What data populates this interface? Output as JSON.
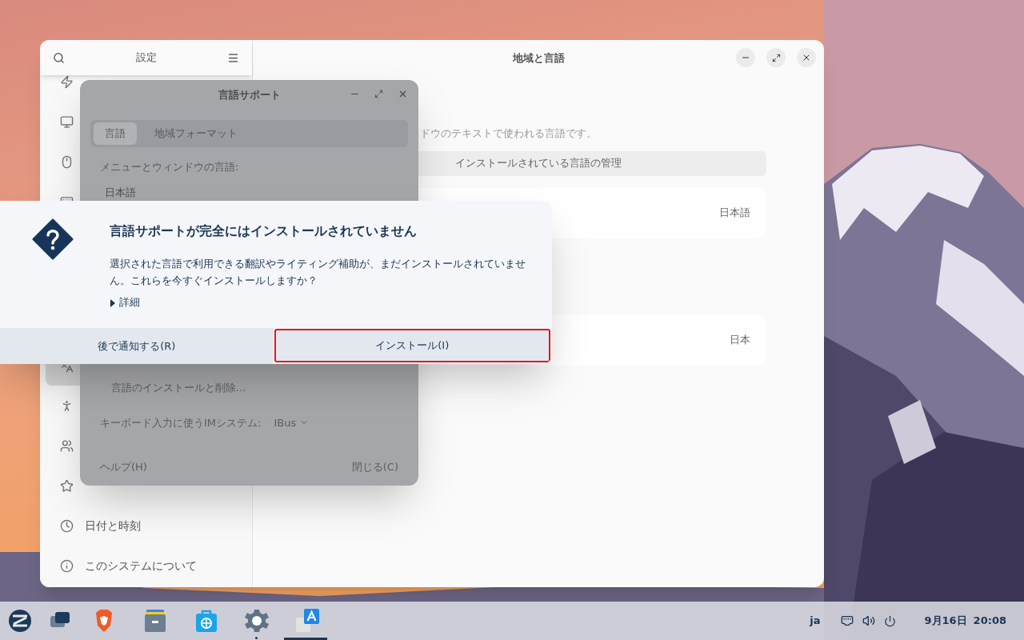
{
  "settings_window": {
    "sidebar": {
      "title": "設定",
      "items_top": [
        {
          "selected": false
        },
        {
          "selected": false
        },
        {
          "selected": false
        },
        {
          "selected": false
        }
      ],
      "items_bottom": [
        {
          "selected": true
        },
        {
          "selected": false
        },
        {
          "selected": false
        },
        {
          "selected": false
        },
        {
          "label": "日付と時刻",
          "selected": false
        },
        {
          "label": "このシステムについて",
          "selected": false
        }
      ]
    },
    "title": "地域と言語",
    "description": "ドウのテキストで使われる言語です。",
    "manage_button": "インストールされている言語の管理",
    "rows": [
      {
        "value": "日本語"
      },
      {
        "value": "日本"
      }
    ]
  },
  "language_support": {
    "title": "言語サポート",
    "tabs": [
      {
        "label": "言語",
        "selected": true
      },
      {
        "label": "地域フォーマット",
        "selected": false
      }
    ],
    "language_label": "メニューとウィンドウの言語:",
    "languages": [
      "日本語"
    ],
    "install_button": "言語のインストールと削除...",
    "im_label": "キーボード入力に使うIMシステム:",
    "im_value": "IBus",
    "help_button": "ヘルプ(H)",
    "close_button": "閉じる(C)"
  },
  "dialog": {
    "title": "言語サポートが完全にはインストールされていません",
    "message": "選択された言語で利用できる翻訳やライティング補助が、まだインストールされていません。これらを今すぐインストールしますか？",
    "details": "詳細",
    "details_expanded": false,
    "buttons": [
      {
        "label": "後で通知する(R)",
        "highlighted": false
      },
      {
        "label": "インストール(I)",
        "highlighted": true
      }
    ]
  },
  "taskbar": {
    "apps": [
      {
        "running": false,
        "selected": false
      },
      {
        "running": false,
        "selected": false
      },
      {
        "running": false,
        "selected": false
      },
      {
        "running": false,
        "selected": false
      },
      {
        "running": false,
        "selected": false
      },
      {
        "running": true,
        "selected": false
      },
      {
        "running": true,
        "selected": true
      }
    ],
    "keyboard_layout": "ja",
    "date": "9月16日",
    "time": "20:08"
  }
}
